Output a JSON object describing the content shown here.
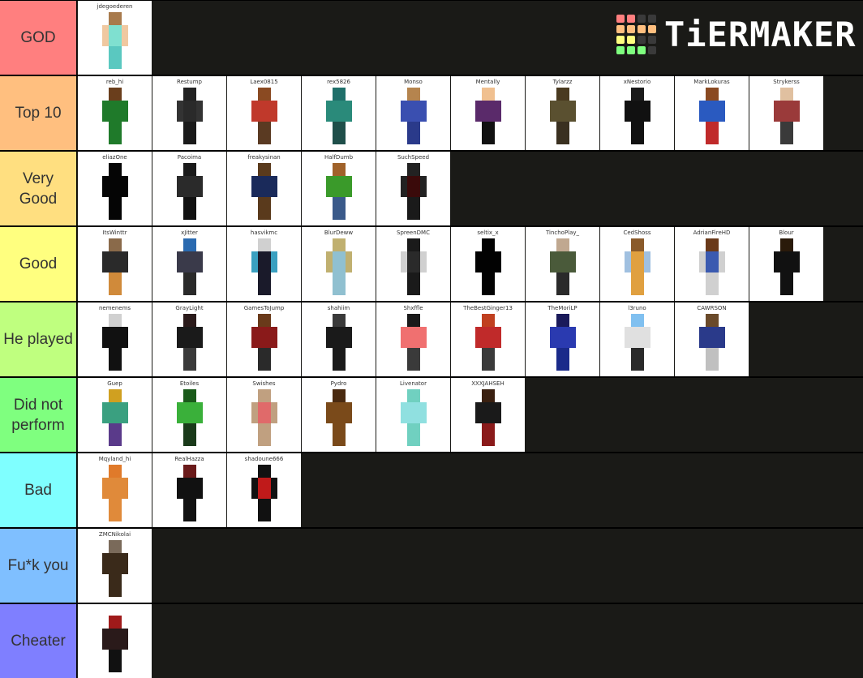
{
  "logo": {
    "text": "TiERMAKER",
    "grid_colors": [
      "#ff7f7f",
      "#ff7f7f",
      "#3a3a3a",
      "#3a3a3a",
      "#ffbf7f",
      "#ffbf7f",
      "#ffbf7f",
      "#ffbf7f",
      "#ffff7f",
      "#ffff7f",
      "#3a3a3a",
      "#3a3a3a",
      "#7fff7f",
      "#7fff7f",
      "#7fff7f",
      "#3a3a3a"
    ]
  },
  "tiers": [
    {
      "label": "GOD",
      "color": "#ff7f7f",
      "items": [
        {
          "name": "jdegoederen",
          "skin": {
            "head": "#a87a4c",
            "body": "#7fe0d0",
            "legs": "#5ac8c0",
            "arms": "#f0c8a0"
          }
        }
      ]
    },
    {
      "label": "Top 10",
      "color": "#ffbf7f",
      "items": [
        {
          "name": "reb_hi",
          "skin": {
            "head": "#6a3e1c",
            "body": "#1f7a2a",
            "legs": "#1f7a2a",
            "arms": "#1f7a2a"
          }
        },
        {
          "name": "Restump",
          "skin": {
            "head": "#222222",
            "body": "#2a2a2a",
            "legs": "#1a1a1a",
            "arms": "#333333"
          }
        },
        {
          "name": "Laex0815",
          "skin": {
            "head": "#8a4a22",
            "body": "#c0392b",
            "legs": "#5a3a22",
            "arms": "#c0392b"
          }
        },
        {
          "name": "rex5826",
          "skin": {
            "head": "#1f6f6a",
            "body": "#2a8a7a",
            "legs": "#1f4f4a",
            "arms": "#2a8a7a"
          }
        },
        {
          "name": "Monso",
          "skin": {
            "head": "#b5844e",
            "body": "#3a4fb0",
            "legs": "#2a3a8a",
            "arms": "#3a4fb0"
          }
        },
        {
          "name": "Mentally",
          "skin": {
            "head": "#f0c090",
            "body": "#5a2a6a",
            "legs": "#111111",
            "arms": "#5a2a6a"
          }
        },
        {
          "name": "Tylarzz",
          "skin": {
            "head": "#4a3a20",
            "body": "#5a5030",
            "legs": "#3a3020",
            "arms": "#5a5030"
          }
        },
        {
          "name": "xNestorio",
          "skin": {
            "head": "#1a1a1a",
            "body": "#111111",
            "legs": "#111111",
            "arms": "#111111"
          }
        },
        {
          "name": "MarkLokuras",
          "skin": {
            "head": "#8a4a22",
            "body": "#2a5ac0",
            "legs": "#c02a2a",
            "arms": "#2a5ac0"
          }
        },
        {
          "name": "Strykerss",
          "skin": {
            "head": "#e0c0a0",
            "body": "#9a3a3a",
            "legs": "#3a3a3a",
            "arms": "#9a3a3a"
          }
        }
      ]
    },
    {
      "label": "Very Good",
      "color": "#ffdf80",
      "items": [
        {
          "name": "eliazOne",
          "skin": {
            "head": "#050505",
            "body": "#050505",
            "legs": "#050505",
            "arms": "#050505"
          }
        },
        {
          "name": "Pacoima",
          "skin": {
            "head": "#1a1a1a",
            "body": "#2a2a2a",
            "legs": "#111111",
            "arms": "#2a2a2a"
          }
        },
        {
          "name": "freakysinan",
          "skin": {
            "head": "#5a3a1c",
            "body": "#1a2a5a",
            "legs": "#5a3a1c",
            "arms": "#1a2a5a"
          }
        },
        {
          "name": "HalfDumb",
          "skin": {
            "head": "#a0622a",
            "body": "#3a9a2a",
            "legs": "#3a5a8a",
            "arms": "#3a9a2a"
          }
        },
        {
          "name": "SuchSpeed",
          "skin": {
            "head": "#222222",
            "body": "#3a0a0a",
            "legs": "#1a1a1a",
            "arms": "#222222"
          }
        }
      ]
    },
    {
      "label": "Good",
      "color": "#ffff7f",
      "items": [
        {
          "name": "ItsWinttr",
          "skin": {
            "head": "#8a6a4a",
            "body": "#2a2a2a",
            "legs": "#d08a3a",
            "arms": "#2a2a2a"
          }
        },
        {
          "name": "xJitter",
          "skin": {
            "head": "#2a6ab0",
            "body": "#3a3a4a",
            "legs": "#2a2a2a",
            "arms": "#3a3a4a"
          }
        },
        {
          "name": "hasvikmc",
          "skin": {
            "head": "#d0d0d0",
            "body": "#1a1a2a",
            "legs": "#1a1a2a",
            "arms": "#3aa0c0"
          }
        },
        {
          "name": "BlurDeww",
          "skin": {
            "head": "#c0b070",
            "body": "#90c0d0",
            "legs": "#90c0d0",
            "arms": "#c0b070"
          }
        },
        {
          "name": "SpreenDMC",
          "skin": {
            "head": "#1a1a1a",
            "body": "#2a2a2a",
            "legs": "#1a1a1a",
            "arms": "#d0d0d0"
          }
        },
        {
          "name": "seltix_x",
          "skin": {
            "head": "#020202",
            "body": "#020202",
            "legs": "#020202",
            "arms": "#020202"
          }
        },
        {
          "name": "TinchoPlay_",
          "skin": {
            "head": "#c0a890",
            "body": "#4a5a3a",
            "legs": "#2a2a2a",
            "arms": "#4a5a3a"
          }
        },
        {
          "name": "CedShoss",
          "skin": {
            "head": "#8a5a2a",
            "body": "#e0a040",
            "legs": "#e0a040",
            "arms": "#a0c0e0"
          }
        },
        {
          "name": "AdrianFireHD",
          "skin": {
            "head": "#6a3a1a",
            "body": "#3a5ab0",
            "legs": "#d0d0d0",
            "arms": "#d0d0d0"
          }
        },
        {
          "name": "Blour",
          "skin": {
            "head": "#2a1a0a",
            "body": "#111111",
            "legs": "#111111",
            "arms": "#111111"
          }
        }
      ]
    },
    {
      "label": "He played",
      "color": "#bfff7f",
      "items": [
        {
          "name": "nemenems",
          "skin": {
            "head": "#d0d0d0",
            "body": "#111111",
            "legs": "#111111",
            "arms": "#111111"
          }
        },
        {
          "name": "GrayLight",
          "skin": {
            "head": "#2a1a1a",
            "body": "#1a1a1a",
            "legs": "#3a3a3a",
            "arms": "#1a1a1a"
          }
        },
        {
          "name": "GamesToJump",
          "skin": {
            "head": "#6a3a1a",
            "body": "#8a1a1a",
            "legs": "#2a2a2a",
            "arms": "#8a1a1a"
          }
        },
        {
          "name": "shahiim",
          "skin": {
            "head": "#3a3a3a",
            "body": "#1a1a1a",
            "legs": "#1a1a1a",
            "arms": "#1a1a1a"
          }
        },
        {
          "name": "Shxffle",
          "skin": {
            "head": "#1a1a1a",
            "body": "#f07070",
            "legs": "#3a3a3a",
            "arms": "#f07070"
          }
        },
        {
          "name": "TheBestGinger13",
          "skin": {
            "head": "#c04020",
            "body": "#c02a2a",
            "legs": "#3a3a3a",
            "arms": "#c02a2a"
          }
        },
        {
          "name": "TheMoriLP",
          "skin": {
            "head": "#1a1a5a",
            "body": "#2a3ab0",
            "legs": "#1a2a8a",
            "arms": "#2a3ab0"
          }
        },
        {
          "name": "l3runo",
          "skin": {
            "head": "#80c0f0",
            "body": "#e0e0e0",
            "legs": "#2a2a2a",
            "arms": "#e0e0e0"
          }
        },
        {
          "name": "CAWRSON",
          "skin": {
            "head": "#6a4a2a",
            "body": "#2a3a8a",
            "legs": "#c0c0c0",
            "arms": "#2a3a8a"
          }
        }
      ]
    },
    {
      "label": "Did not perform",
      "color": "#7fff7f",
      "items": [
        {
          "name": "Guep",
          "skin": {
            "head": "#d0a020",
            "body": "#3aa080",
            "legs": "#5a3a8a",
            "arms": "#3aa080"
          }
        },
        {
          "name": "Etoiles",
          "skin": {
            "head": "#1a5a1a",
            "body": "#3ab03a",
            "legs": "#1a3a1a",
            "arms": "#3ab03a"
          }
        },
        {
          "name": "Swishes",
          "skin": {
            "head": "#c0a080",
            "body": "#e06a6a",
            "legs": "#c0a080",
            "arms": "#c0a080"
          }
        },
        {
          "name": "Pydro",
          "skin": {
            "head": "#4a2a10",
            "body": "#7a4a1a",
            "legs": "#7a4a1a",
            "arms": "#7a4a1a"
          }
        },
        {
          "name": "Livenator",
          "skin": {
            "head": "#70d0c0",
            "body": "#90e0e0",
            "legs": "#70d0c0",
            "arms": "#90e0e0"
          }
        },
        {
          "name": "XXXJAHSEH",
          "skin": {
            "head": "#3a2010",
            "body": "#1a1a1a",
            "legs": "#8a1a1a",
            "arms": "#1a1a1a"
          }
        }
      ]
    },
    {
      "label": "Bad",
      "color": "#7fffff",
      "items": [
        {
          "name": "Mqyland_hi",
          "skin": {
            "head": "#e07a2a",
            "body": "#e08a3a",
            "legs": "#e08a3a",
            "arms": "#e08a3a"
          }
        },
        {
          "name": "RealHazza",
          "skin": {
            "head": "#6a1a1a",
            "body": "#111111",
            "legs": "#111111",
            "arms": "#111111"
          }
        },
        {
          "name": "shadoune666",
          "skin": {
            "head": "#111111",
            "body": "#c01a1a",
            "legs": "#111111",
            "arms": "#111111"
          }
        }
      ]
    },
    {
      "label": "Fu*k you",
      "color": "#7fbfff",
      "items": [
        {
          "name": "ZMCNikolai",
          "skin": {
            "head": "#7a6a5a",
            "body": "#3a2a1a",
            "legs": "#3a2a1a",
            "arms": "#3a2a1a"
          }
        }
      ]
    },
    {
      "label": "Cheater",
      "color": "#7f7fff",
      "items": [
        {
          "name": "",
          "skin": {
            "head": "#a01a1a",
            "body": "#2a1a1a",
            "legs": "#111111",
            "arms": "#2a1a1a"
          }
        }
      ]
    }
  ]
}
